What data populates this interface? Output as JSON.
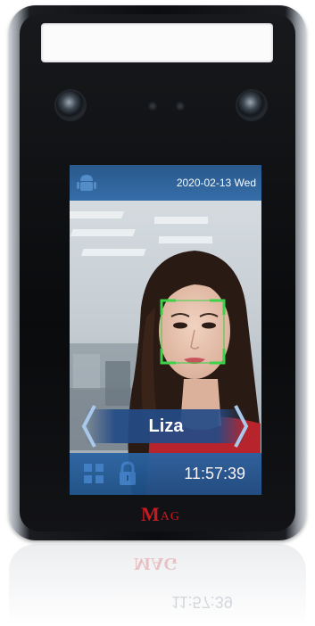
{
  "screen": {
    "date": "2020-02-13 Wed",
    "recognized_name": "Liza",
    "time": "11:57:39"
  },
  "logo": {
    "m": "M",
    "ag": "AG"
  },
  "colors": {
    "bar_blue": "#2a66a5",
    "face_box_green": "#3fd24a",
    "logo_red": "#c8191e"
  },
  "icons": [
    "android-icon",
    "grid-icon",
    "lock-icon",
    "chevron-left-icon",
    "chevron-right-icon"
  ]
}
